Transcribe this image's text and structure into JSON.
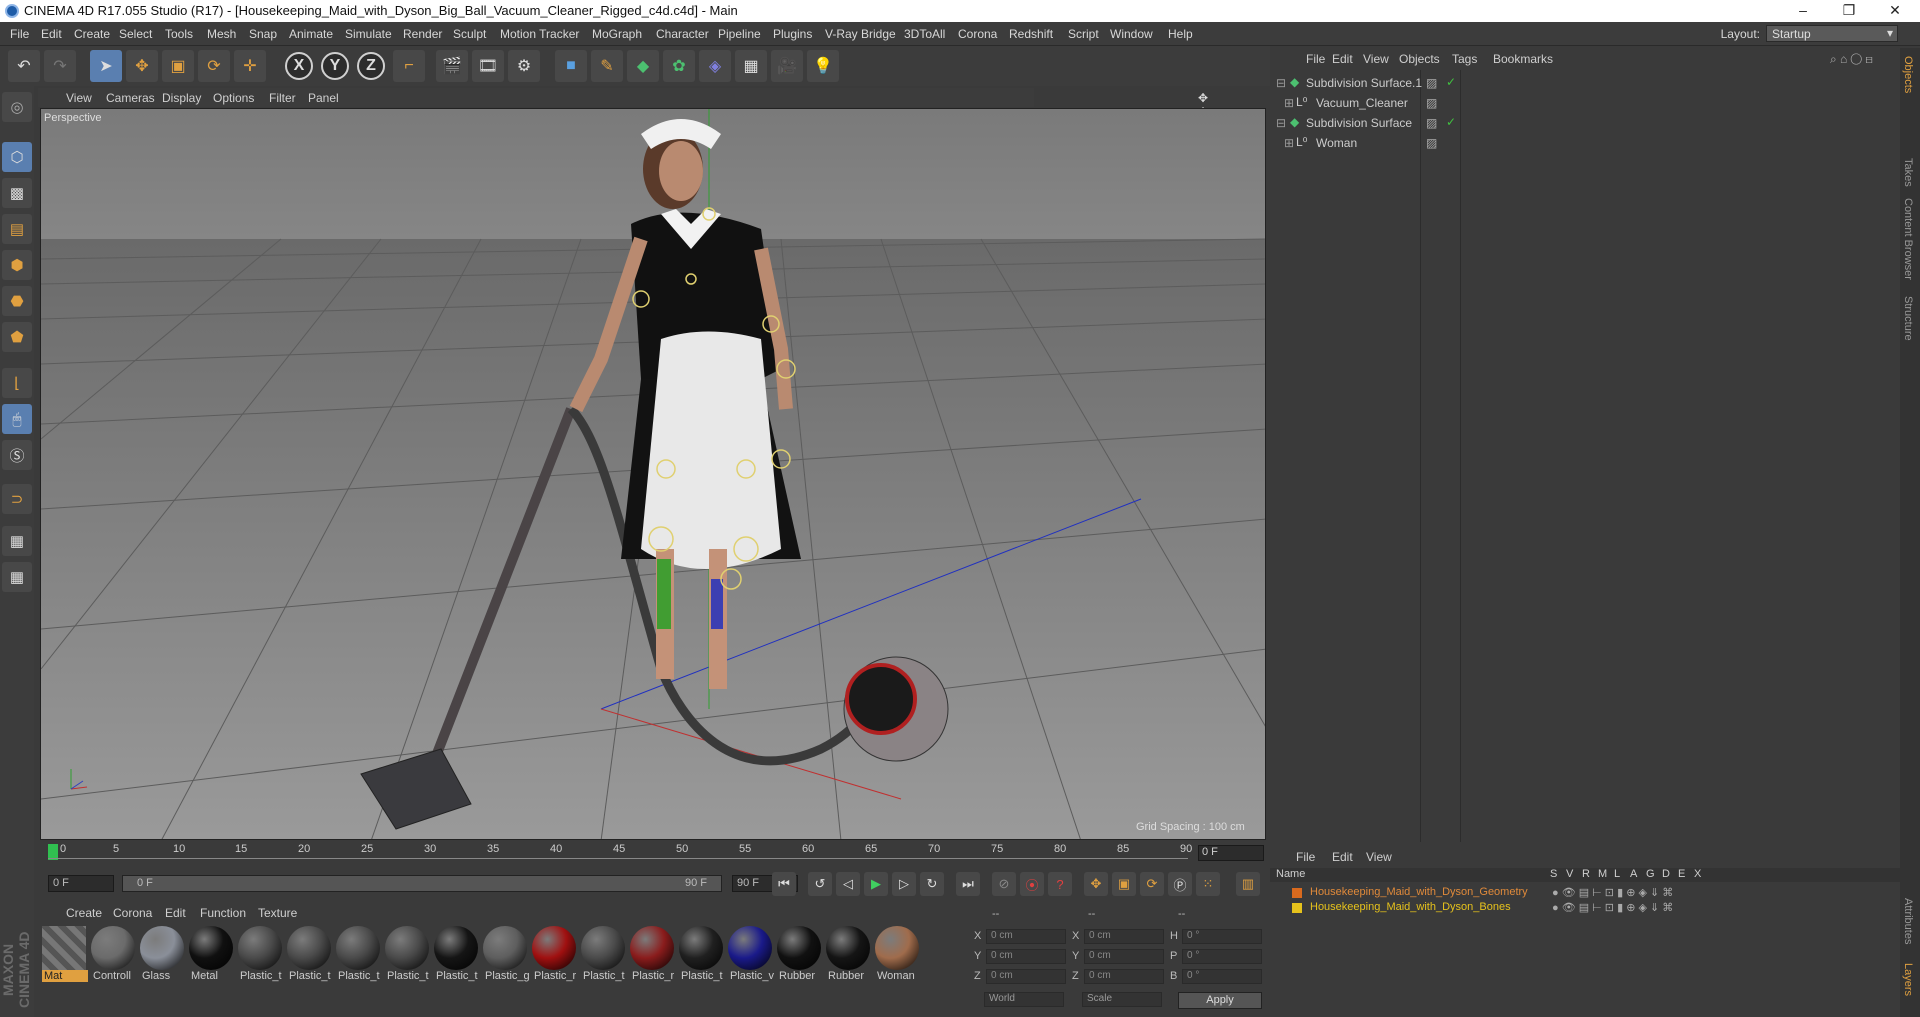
{
  "titlebar": {
    "title": "CINEMA 4D R17.055 Studio (R17) - [Housekeeping_Maid_with_Dyson_Big_Ball_Vacuum_Cleaner_Rigged_c4d.c4d] - Main",
    "minimize": "–",
    "restore": "❐",
    "close": "✕"
  },
  "menubar": {
    "items": [
      "File",
      "Edit",
      "Create",
      "Select",
      "Tools",
      "Mesh",
      "Snap",
      "Animate",
      "Simulate",
      "Render",
      "Sculpt",
      "Motion Tracker",
      "MoGraph",
      "Character",
      "Pipeline",
      "Plugins",
      "V-Ray Bridge",
      "3DToAll",
      "Corona",
      "Redshift",
      "Script",
      "Window",
      "Help"
    ],
    "layout_label": "Layout:",
    "layout_value": "Startup"
  },
  "toolbar": {
    "icons": [
      "undo-icon",
      "redo-icon",
      "select-arrow-icon",
      "move-icon",
      "scale-icon",
      "rotate-icon",
      "move-alt-icon",
      "x-axis-icon",
      "y-axis-icon",
      "z-axis-icon",
      "coordinate-system-icon",
      "render-view-icon",
      "render-picture-viewer-icon",
      "edit-render-settings-icon",
      "cube-icon",
      "pen-icon",
      "subdivision-icon",
      "array-icon",
      "deformer-icon",
      "floor-icon",
      "camera-icon",
      "light-icon"
    ],
    "axis_labels": [
      "X",
      "Y",
      "Z"
    ]
  },
  "viewport": {
    "menu": [
      "View",
      "Cameras",
      "Display",
      "Options",
      "Filter",
      "Panel"
    ],
    "label": "Perspective",
    "grid_spacing": "Grid Spacing : 100 cm"
  },
  "timeline": {
    "ticks": [
      "0",
      "5",
      "10",
      "15",
      "20",
      "25",
      "30",
      "35",
      "40",
      "45",
      "50",
      "55",
      "60",
      "65",
      "70",
      "75",
      "80",
      "85",
      "90"
    ],
    "current_frame": "0 F"
  },
  "transport": {
    "start_field": "0 F",
    "range_start": "0 F",
    "range_end": "90 F",
    "end_field": "90 F"
  },
  "materials": {
    "menu": [
      "Create",
      "Corona",
      "Edit",
      "Function",
      "Texture"
    ],
    "items": [
      {
        "label": "Mat",
        "color": "#888888"
      },
      {
        "label": "Controll",
        "color": "#6b6b6b"
      },
      {
        "label": "Glass",
        "color": "#8a8f99"
      },
      {
        "label": "Metal",
        "color": "#101010"
      },
      {
        "label": "Plastic_t",
        "color": "#4a4a4a"
      },
      {
        "label": "Plastic_t",
        "color": "#4a4a4a"
      },
      {
        "label": "Plastic_t",
        "color": "#4a4a4a"
      },
      {
        "label": "Plastic_t",
        "color": "#4a4a4a"
      },
      {
        "label": "Plastic_t",
        "color": "#151515"
      },
      {
        "label": "Plastic_g",
        "color": "#5e5e5e"
      },
      {
        "label": "Plastic_r",
        "color": "#a01010"
      },
      {
        "label": "Plastic_t",
        "color": "#4a4a4a"
      },
      {
        "label": "Plastic_r",
        "color": "#8a1c1c"
      },
      {
        "label": "Plastic_t",
        "color": "#202020"
      },
      {
        "label": "Plastic_v",
        "color": "#1a1a8a"
      },
      {
        "label": "Rubber",
        "color": "#111111"
      },
      {
        "label": "Rubber",
        "color": "#151515"
      },
      {
        "label": "Woman",
        "color": "#a06c4c"
      }
    ]
  },
  "coordinates": {
    "header": [
      "--",
      "--",
      "--"
    ],
    "rows": [
      {
        "l1": "X",
        "v1": "0 cm",
        "l2": "X",
        "v2": "0 cm",
        "l3": "H",
        "v3": "0 °"
      },
      {
        "l1": "Y",
        "v1": "0 cm",
        "l2": "Y",
        "v2": "0 cm",
        "l3": "P",
        "v3": "0 °"
      },
      {
        "l1": "Z",
        "v1": "0 cm",
        "l2": "Z",
        "v2": "0 cm",
        "l3": "B",
        "v3": "0 °"
      }
    ],
    "space": "World",
    "mode": "Scale",
    "apply": "Apply"
  },
  "objects": {
    "menu": [
      "File",
      "Edit",
      "View",
      "Objects",
      "Tags",
      "Bookmarks"
    ],
    "rows": [
      {
        "name": "Subdivision Surface.1",
        "type": "subdivision"
      },
      {
        "name": "Vacuum_Cleaner",
        "type": "null"
      },
      {
        "name": "Subdivision Surface",
        "type": "subdivision"
      },
      {
        "name": "Woman",
        "type": "null"
      }
    ]
  },
  "layers": {
    "menu": [
      "File",
      "Edit",
      "View"
    ],
    "col_name": "Name",
    "cols": [
      "S",
      "V",
      "R",
      "M",
      "L",
      "A",
      "G",
      "D",
      "E",
      "X"
    ],
    "rows": [
      {
        "name": "Housekeeping_Maid_with_Dyson_Geometry",
        "color": "#d96a1e"
      },
      {
        "name": "Housekeeping_Maid_with_Dyson_Bones",
        "color": "#e6c21c"
      }
    ]
  },
  "sidetabs": [
    "Objects",
    "Takes",
    "Content Browser",
    "Structure",
    "Attributes",
    "Layers"
  ],
  "maxon": "MAXON CINEMA 4D"
}
